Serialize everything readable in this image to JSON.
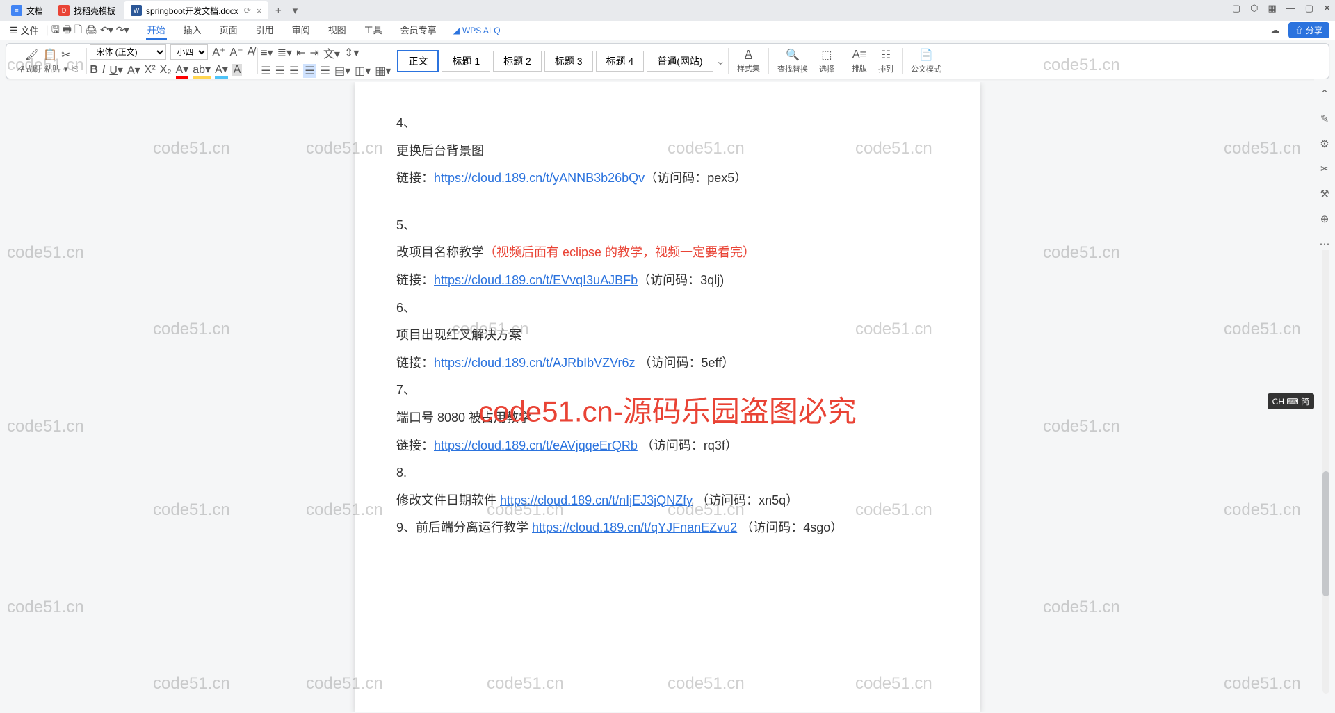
{
  "tabs": [
    {
      "label": "文档",
      "iconBg": "#4285f4"
    },
    {
      "label": "找稻壳模板",
      "iconBg": "#e94335"
    },
    {
      "label": "springboot开发文档.docx",
      "iconBg": "#2b5797",
      "active": true
    }
  ],
  "menu": {
    "file": "文件"
  },
  "ribbonTabs": [
    "开始",
    "插入",
    "页面",
    "引用",
    "审阅",
    "视图",
    "工具",
    "会员专享"
  ],
  "wpsAi": "WPS AI",
  "font": {
    "name": "宋体 (正文)",
    "size": "小四"
  },
  "styles": [
    "正文",
    "标题 1",
    "标题 2",
    "标题 3",
    "标题 4",
    "普通(网站)"
  ],
  "groups": {
    "fmt": "格式刷",
    "paste": "粘贴",
    "styleSet": "样式集",
    "findRep": "查找替换",
    "select": "选择",
    "sort": "排版",
    "align": "排列",
    "docMode": "公文模式"
  },
  "share": "分享",
  "doc": {
    "l1": "4、",
    "l2": "更换后台背景图",
    "l3a": "链接：",
    "l3b": "https://cloud.189.cn/t/yANNB3b26bQv",
    "l3c": "（访问码：pex5）",
    "l4": "5、",
    "l5a": "改项目名称教学",
    "l5b": "（视频后面有 eclipse 的教学，视频一定要看完）",
    "l6a": "链接：",
    "l6b": "https://cloud.189.cn/t/EVvqI3uAJBFb",
    "l6c": "（访问码：3qlj)",
    "l7": "6、",
    "l8": "项目出现红叉解决方案",
    "l9a": "链接：",
    "l9b": "https://cloud.189.cn/t/AJRbIbVZVr6z",
    "l9c": " （访问码：5eff）",
    "l10": "7、",
    "l11": "端口号 8080 被占用教学",
    "l12a": "链接：",
    "l12b": "https://cloud.189.cn/t/eAVjqqeErQRb",
    "l12c": "  （访问码：rq3f）",
    "l13": "8.",
    "l14a": "修改文件日期软件 ",
    "l14b": "https://cloud.189.cn/t/nIjEJ3jQNZfy",
    "l14c": "  （访问码：xn5q）",
    "l15a": "9、前后端分离运行教学 ",
    "l15b": "https://cloud.189.cn/t/qYJFnanEZvu2",
    "l15c": "  （访问码：4sgo）"
  },
  "wmText": "code51.cn",
  "wmBig": "code51.cn-源码乐园盗图必究",
  "ime": "CH ⌨ 简"
}
